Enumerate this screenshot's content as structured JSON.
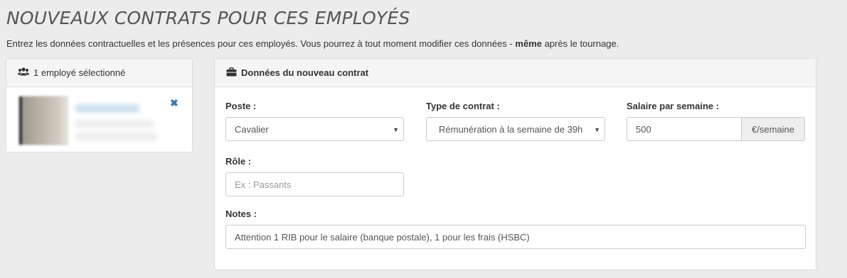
{
  "page": {
    "title": "NOUVEAUX CONTRATS POUR CES EMPLOYÉS",
    "intro_before": "Entrez les données contractuelles et les présences pour ces employés. Vous pourrez à tout moment modifier ces données - ",
    "intro_bold": "même",
    "intro_after": " après le tournage."
  },
  "employees_panel": {
    "heading": "1 employé sélectionné",
    "icon": "users-icon",
    "remove_icon": "close-icon"
  },
  "contract_panel": {
    "heading": "Données du nouveau contrat",
    "icon": "briefcase-icon",
    "poste": {
      "label": "Poste :",
      "value": "Cavalier"
    },
    "type_contrat": {
      "label": "Type de contrat :",
      "value": "Rémunération à la semaine de 39h"
    },
    "salaire": {
      "label": "Salaire par semaine :",
      "value": "500",
      "unit": "€/semaine"
    },
    "role": {
      "label": "Rôle :",
      "placeholder": "Ex : Passants"
    },
    "notes": {
      "label": "Notes :",
      "value": "Attention 1 RIB pour le salaire (banque postale), 1 pour les frais (HSBC)"
    }
  },
  "colors": {
    "background": "#ececec",
    "panel_heading": "#f5f5f5",
    "link_blue": "#3c7bb5"
  }
}
